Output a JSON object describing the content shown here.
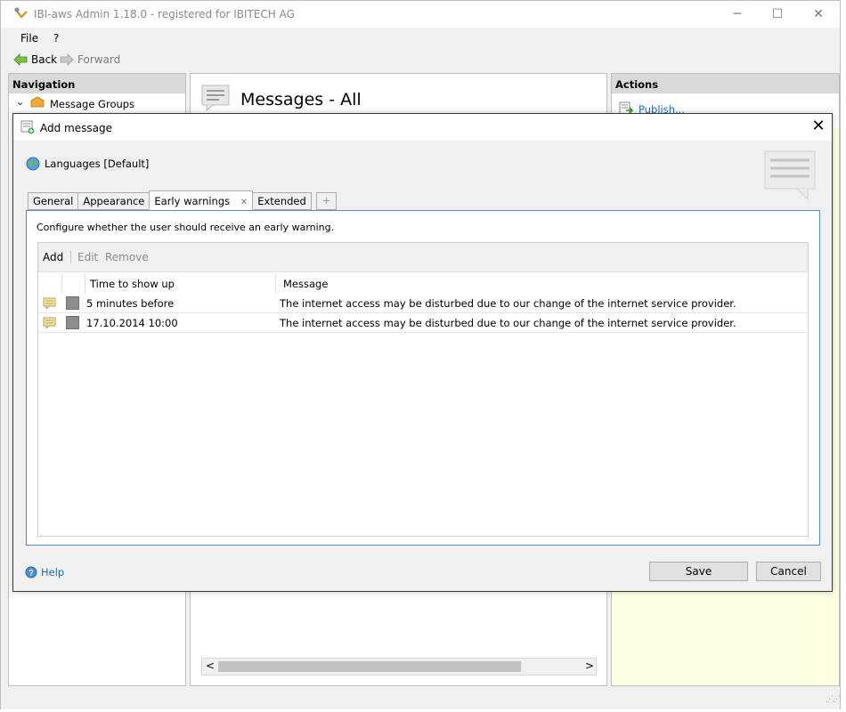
{
  "window": {
    "title": "IBI-aws Admin 1.18.0 - registered for IBITECH AG",
    "minimize": "─",
    "maximize": "☐",
    "close": "✕"
  },
  "menu": {
    "file": "File",
    "help": "?"
  },
  "nav": {
    "back": "Back",
    "forward": "Forward"
  },
  "navigation_panel": {
    "header": "Navigation",
    "tree_item": "Message Groups"
  },
  "center_panel": {
    "title": "Messages - All"
  },
  "actions_panel": {
    "header": "Actions",
    "publish": "Publish..."
  },
  "dialog": {
    "title": "Add message",
    "close": "✕",
    "languages": "Languages [Default]",
    "tabs": [
      "General",
      "Appearance",
      "Early warnings",
      "Extended"
    ],
    "tab_close": "✕",
    "tab_add": "+",
    "description": "Configure whether the user should receive an early warning.",
    "toolbar": {
      "add": "Add",
      "edit": "Edit",
      "remove": "Remove"
    },
    "columns": [
      "Time to show up",
      "Message"
    ],
    "rows": [
      {
        "time": "5 minutes before",
        "message": "The internet access may be disturbed due to our change of the internet service provider."
      },
      {
        "time": "17.10.2014 10:00",
        "message": "The internet access may be disturbed due to our change of the internet service provider."
      }
    ],
    "help": "Help",
    "save": "Save",
    "cancel": "Cancel"
  },
  "scroll": {
    "left": "<",
    "right": ">"
  },
  "colors": {
    "accent": "#4e8fc9",
    "link": "#1a6fbf",
    "actions_bg": "#ffffe1"
  }
}
